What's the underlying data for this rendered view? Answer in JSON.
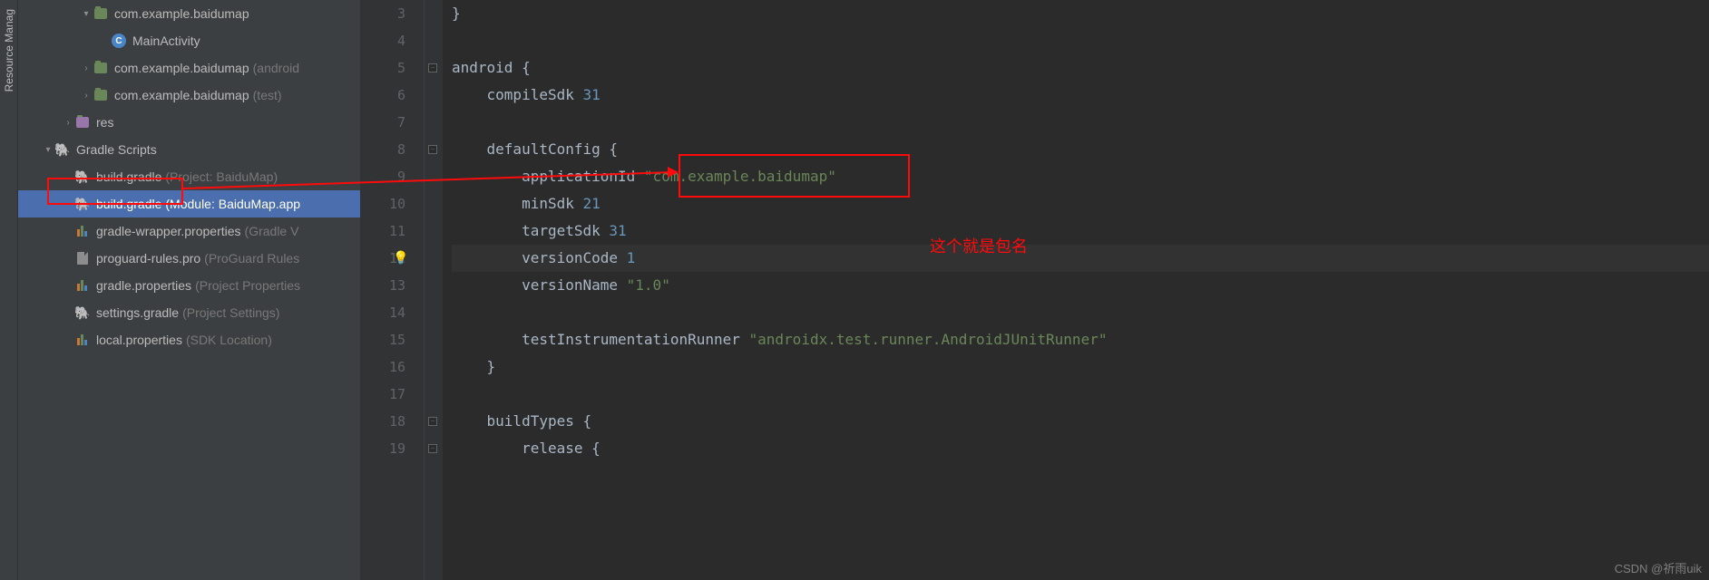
{
  "sideTab": "Resource Manag",
  "tree": {
    "pkg1": "com.example.baidumap",
    "mainActivity": "MainActivity",
    "pkg2": "com.example.baidumap",
    "pkg2hint": "(android",
    "pkg3": "com.example.baidumap",
    "pkg3hint": "(test)",
    "res": "res",
    "gradleScripts": "Gradle Scripts",
    "bg1": "build.gradle",
    "bg1hint": "(Project: BaiduMap)",
    "bg2": "build.gradle",
    "bg2hint": "(Module: BaiduMap.app",
    "gwp": "gradle-wrapper.properties",
    "gwphint": "(Gradle V",
    "pro": "proguard-rules.pro",
    "prohint": "(ProGuard Rules",
    "gp": "gradle.properties",
    "gphint": "(Project Properties",
    "sg": "settings.gradle",
    "sghint": "(Project Settings)",
    "lp": "local.properties",
    "lphint": "(SDK Location)"
  },
  "lines": [
    "3",
    "4",
    "5",
    "6",
    "7",
    "8",
    "9",
    "10",
    "11",
    "12",
    "13",
    "14",
    "15",
    "16",
    "17",
    "18",
    "19"
  ],
  "code": {
    "l3": "}",
    "l5a": "android ",
    "l5b": "{",
    "l6a": "    compileSdk ",
    "l6b": "31",
    "l8a": "    defaultConfig ",
    "l8b": "{",
    "l9a": "        applicationId ",
    "l9b": "\"com.example.baidumap\"",
    "l10a": "        minSdk ",
    "l10b": "21",
    "l11a": "        targetSdk ",
    "l11b": "31",
    "l12a": "        versionCode ",
    "l12b": "1",
    "l13a": "        versionName ",
    "l13b": "\"1.0\"",
    "l15a": "        testInstrumentationRunner ",
    "l15b": "\"androidx.test.runner.AndroidJUnitRunner\"",
    "l16": "    }",
    "l18a": "    buildTypes ",
    "l18b": "{",
    "l19a": "        release ",
    "l19b": "{"
  },
  "annotation": "这个就是包名",
  "watermark": "CSDN @祈雨uik"
}
